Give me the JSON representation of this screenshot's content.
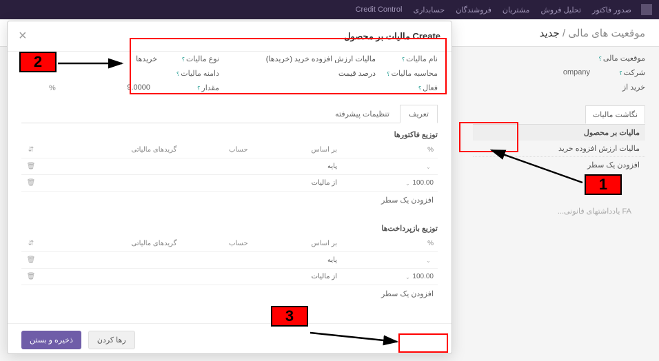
{
  "topnav": {
    "items": [
      "صدور فاکتور",
      "تحلیل فروش",
      "مشتریان",
      "فروشندگان",
      "حسابداری",
      "Credit Control"
    ]
  },
  "breadcrumb": {
    "root": "موقعیت های مالی",
    "current": "جدید"
  },
  "underlying": {
    "field1_label": "موقعیت مالی",
    "field2_label": "شرکت",
    "field2_value": "ompany",
    "field3_label": "خرید از",
    "tab1": "نگاشت مالیات",
    "section_header": "مالیات بر محصول",
    "row1": "مالیات ارزش افزوده خرید",
    "add_line": "افزودن یک سطر",
    "footer": "FA یادداشتهای قانونی..."
  },
  "modal": {
    "title": "Create مالیات بر محصول",
    "form": {
      "tax_name_lbl": "نام مالیات",
      "tax_name_val": "مالیات ارزش افزوده خرید (خریدها)",
      "tax_calc_lbl": "محاسبه مالیات",
      "tax_calc_val": "درصد قیمت",
      "active_lbl": "فعال",
      "tax_type_lbl": "نوع مالیات",
      "tax_type_val": "خریدها",
      "tax_scope_lbl": "دامنه مالیات",
      "amount_lbl": "مقدار",
      "amount_val": "9.0000",
      "pct": "%"
    },
    "tabs": {
      "t1": "تعریف",
      "t2": "تنظیمات پیشرفته"
    },
    "dist1_title": "توزیع فاکتورها",
    "dist2_title": "توزیع بازپرداخت‌ها",
    "cols": {
      "pct": "%",
      "based": "بر اساس",
      "account": "حساب",
      "grids": "گریدهای مالیاتی"
    },
    "rows": {
      "r1_based": "پایه",
      "r2_pct": "100.00",
      "r2_based": "از مالیات"
    },
    "add_line": "افزودن یک سطر",
    "save": "ذخیره و بستن",
    "discard": "رها کردن"
  }
}
